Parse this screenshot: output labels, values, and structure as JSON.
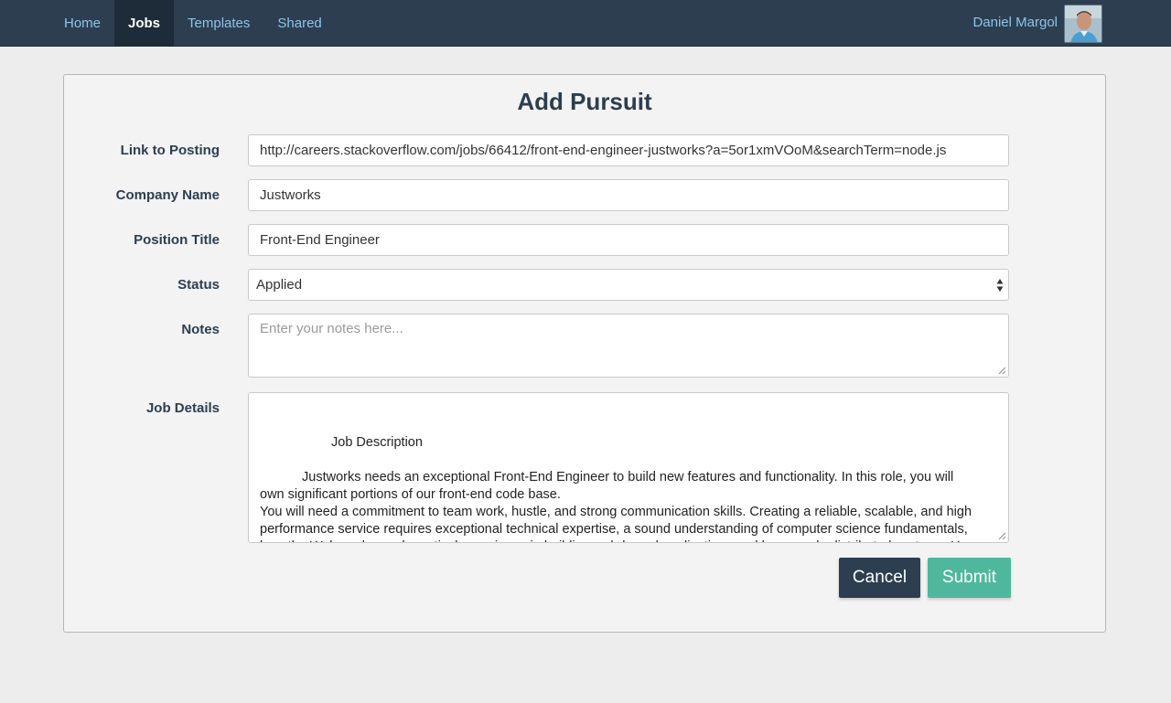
{
  "nav": {
    "links": [
      {
        "label": "Home",
        "active": false
      },
      {
        "label": "Jobs",
        "active": true
      },
      {
        "label": "Templates",
        "active": false
      },
      {
        "label": "Shared",
        "active": false
      }
    ],
    "user_name": "Daniel Margol"
  },
  "form": {
    "title": "Add Pursuit",
    "link": {
      "label": "Link to Posting",
      "value": "http://careers.stackoverflow.com/jobs/66412/front-end-engineer-justworks?a=5or1xmVOoM&searchTerm=node.js"
    },
    "company": {
      "label": "Company Name",
      "value": "Justworks"
    },
    "position": {
      "label": "Position Title",
      "value": "Front-End Engineer"
    },
    "status": {
      "label": "Status",
      "value": "Applied"
    },
    "notes": {
      "label": "Notes",
      "placeholder": "Enter your notes here..."
    },
    "details": {
      "label": "Job Details",
      "heading": "Job Description",
      "para1": "Justworks needs an exceptional Front-End Engineer to build new features and functionality. In this role, you will own significant portions of our front-end code base.",
      "para2": "You will need a commitment to team work, hustle, and strong communication skills. Creating a reliable, scalable, and high performance service requires exceptional technical expertise, a sound understanding of computer science fundamentals, how the Web works, and practical experience in building web-based applications and large-scale distributed systems. You should be"
    },
    "cancel_label": "Cancel",
    "submit_label": "Submit"
  },
  "colors": {
    "navbar": "#2c3e50",
    "nav_link": "#8ec4e8",
    "cancel": "#2c3e50",
    "submit": "#4fb89c"
  }
}
